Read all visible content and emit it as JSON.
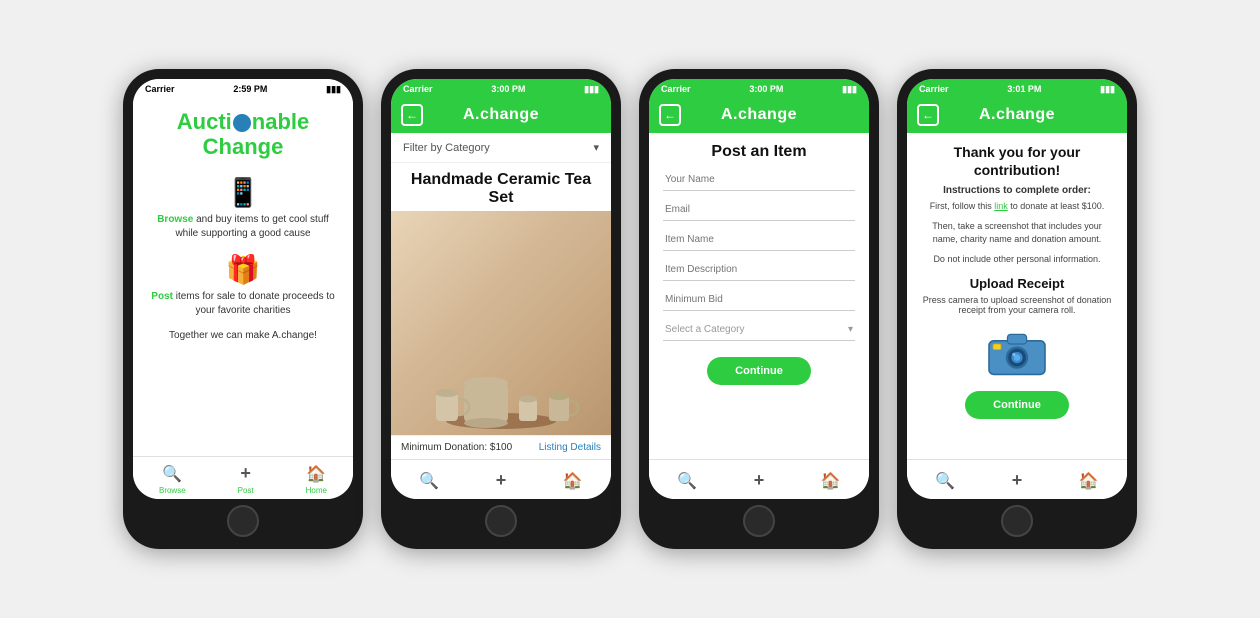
{
  "phones": [
    {
      "id": "phone-home",
      "statusBar": {
        "carrier": "Carrier",
        "signal": "▲",
        "time": "2:59 PM",
        "battery": "▮▮▮"
      },
      "header": null,
      "screen": "home",
      "nav": {
        "items": [
          {
            "label": "Browse",
            "icon": "🔍"
          },
          {
            "label": "Post",
            "icon": "+"
          },
          {
            "label": "Home",
            "icon": "🏠"
          }
        ]
      },
      "home": {
        "logo_line1": "Aucti",
        "logo_line2": "nable",
        "logo_line3": "Change",
        "browse_text": "Browse",
        "browse_desc": " and buy items to get cool stuff while supporting a good cause",
        "post_text": "Post",
        "post_desc": " items for sale to donate proceeds to your favorite charities",
        "tagline_prefix": "Together we can make ",
        "tagline_link": "A.change",
        "tagline_suffix": "!"
      }
    },
    {
      "id": "phone-browse",
      "statusBar": {
        "carrier": "Carrier",
        "signal": "▲",
        "time": "3:00 PM",
        "battery": "▮▮▮"
      },
      "header": {
        "title": "A.change",
        "hasBack": true
      },
      "screen": "browse",
      "nav": {
        "items": [
          {
            "label": "",
            "icon": "🔍"
          },
          {
            "label": "",
            "icon": "+"
          },
          {
            "label": "",
            "icon": "🏠"
          }
        ]
      },
      "browse": {
        "filter_label": "Filter by Category",
        "item_title": "Handmade Ceramic Tea Set",
        "min_donation": "Minimum Donation: $100",
        "listing_link": "Listing Details"
      }
    },
    {
      "id": "phone-post",
      "statusBar": {
        "carrier": "Carrier",
        "signal": "▲",
        "time": "3:00 PM",
        "battery": "▮▮▮"
      },
      "header": {
        "title": "A.change",
        "hasBack": true
      },
      "screen": "post",
      "nav": {
        "items": [
          {
            "label": "",
            "icon": "🔍"
          },
          {
            "label": "",
            "icon": "+"
          },
          {
            "label": "",
            "icon": "🏠"
          }
        ]
      },
      "post": {
        "title": "Post an Item",
        "fields": [
          {
            "placeholder": "Your Name"
          },
          {
            "placeholder": "Email"
          },
          {
            "placeholder": "Item Name"
          },
          {
            "placeholder": "Item Description"
          },
          {
            "placeholder": "Minimum Bid"
          }
        ],
        "select_placeholder": "Select a Category",
        "continue_label": "Continue"
      }
    },
    {
      "id": "phone-thanks",
      "statusBar": {
        "carrier": "Carrier",
        "signal": "▲",
        "time": "3:01 PM",
        "battery": "▮▮▮"
      },
      "header": {
        "title": "A.change",
        "hasBack": true
      },
      "screen": "thanks",
      "nav": {
        "items": [
          {
            "label": "",
            "icon": "🔍"
          },
          {
            "label": "",
            "icon": "+"
          },
          {
            "label": "",
            "icon": "🏠"
          }
        ]
      },
      "thanks": {
        "title": "Thank you for your contribution!",
        "instructions_label": "Instructions to complete order:",
        "step1_prefix": "First, follow this ",
        "step1_link": "link",
        "step1_suffix": " to donate at least $100.",
        "step2": "Then, take a screenshot that includes your name, charity name and donation amount.",
        "step3": "Do not include other personal information.",
        "upload_title": "Upload Receipt",
        "upload_text": "Press camera to upload screenshot of donation receipt from your camera roll.",
        "continue_label": "Continue"
      }
    }
  ]
}
